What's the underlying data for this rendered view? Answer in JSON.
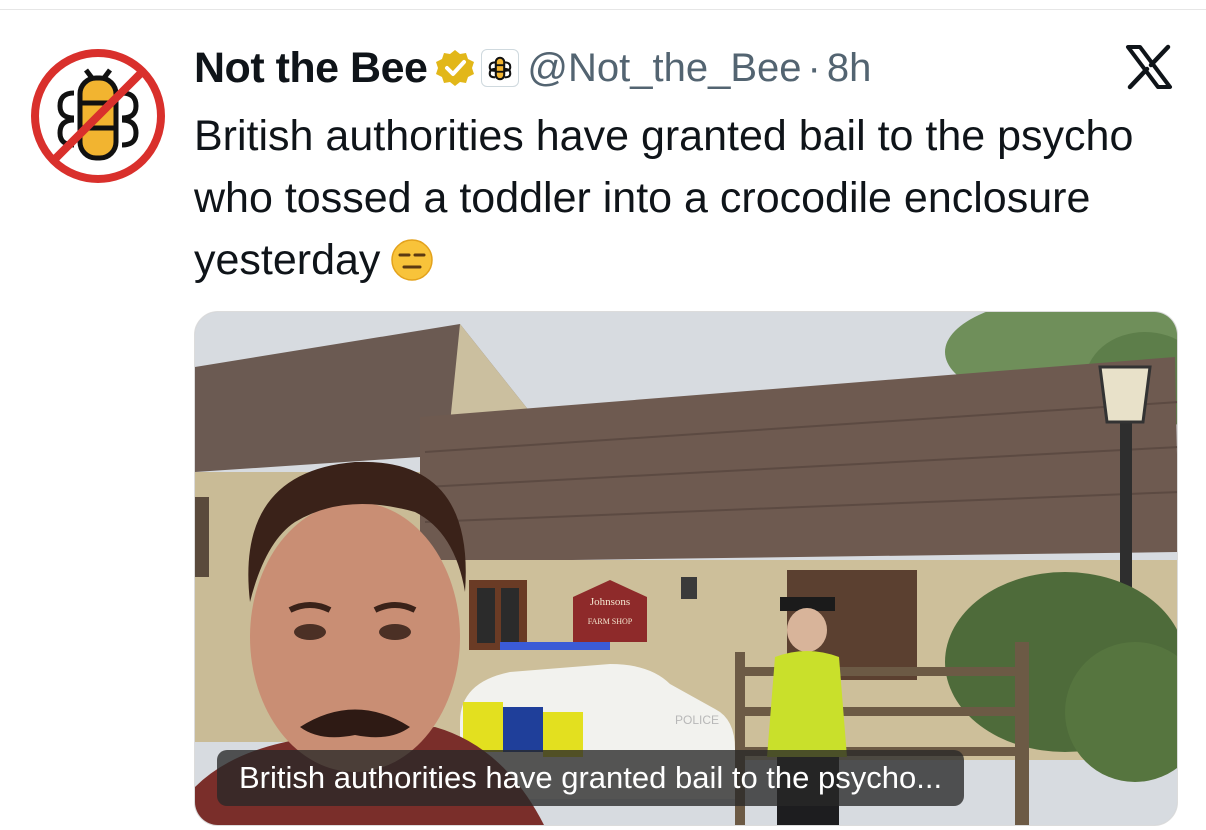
{
  "author": {
    "display_name": "Not the Bee",
    "handle": "@Not_the_Bee",
    "separator": "·",
    "time": "8h",
    "avatar_icon": "not-the-bee-logo-icon",
    "verified_icon": "verified-badge-icon",
    "verified_color": "#e2b719",
    "affiliate_icon": "bee-affiliate-icon"
  },
  "platform": {
    "logo_icon": "x-logo-icon"
  },
  "tweet": {
    "text": "British authorities have granted bail to the psycho who tossed a toddler into a crocodile enclosure yesterday",
    "emoji": "😑"
  },
  "media": {
    "caption": "British authorities have granted bail to the psycho...",
    "sign_text_1": "Johnsons",
    "sign_text_2": "FARM SHOP",
    "car_text": "POLICE"
  },
  "colors": {
    "text": "#0f1419",
    "secondary": "#536471",
    "brand_red": "#d9302c",
    "bee_yellow": "#f2b430"
  }
}
